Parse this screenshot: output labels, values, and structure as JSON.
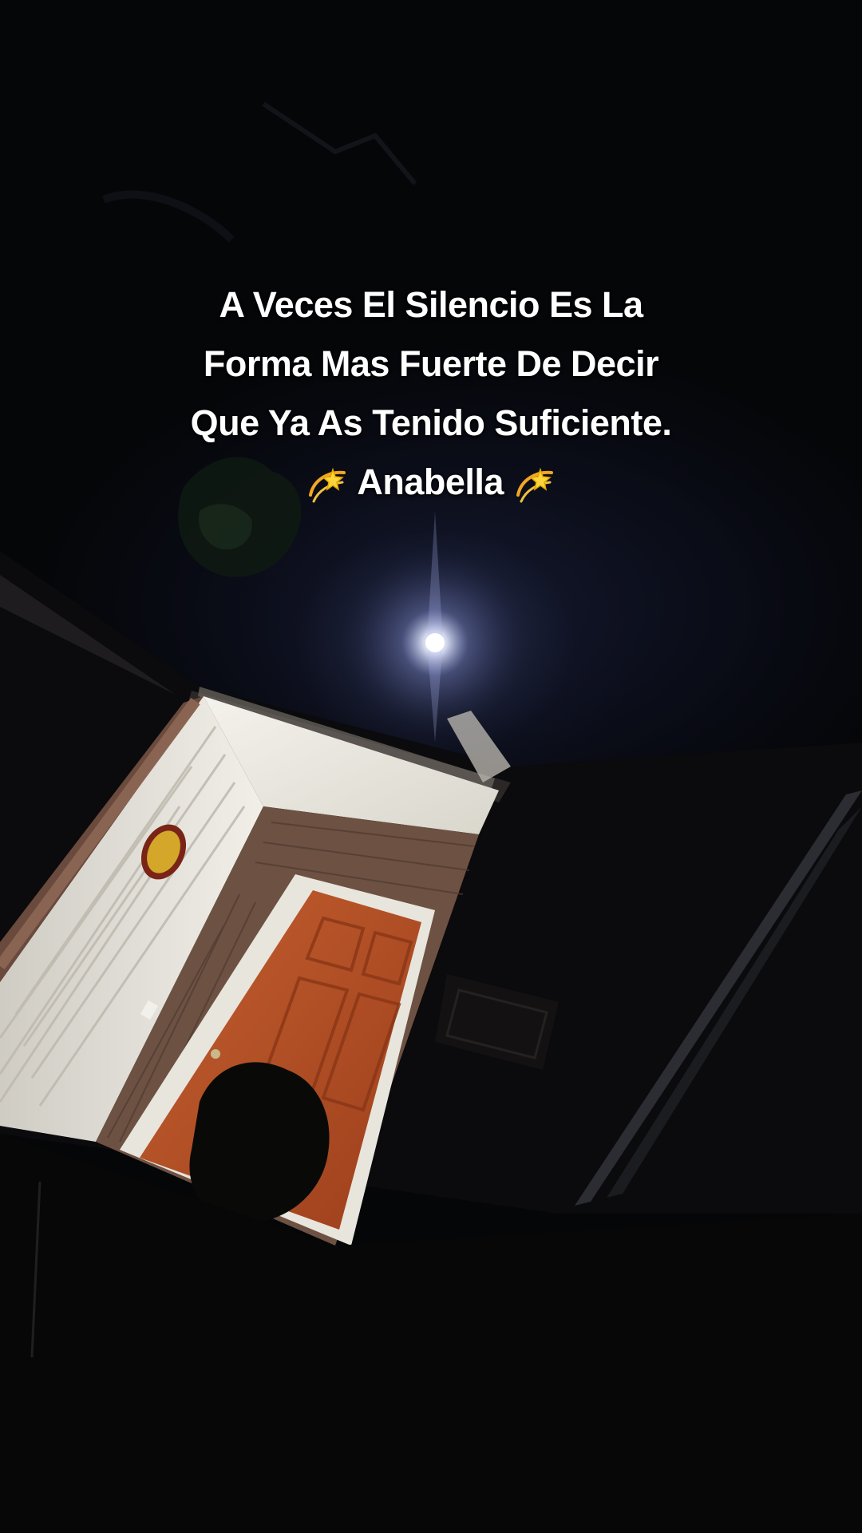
{
  "caption": {
    "lines": [
      "A Veces El Silencio Es La",
      "Forma Mas Fuerte De Decir",
      "Que Ya As Tenido Suficiente."
    ],
    "signature": "Anabella",
    "signature_icon": "dizzy-star-icon"
  },
  "colors": {
    "sky": "#050608",
    "moon_glow": "#cfd8ff",
    "door": "#b8532a",
    "siding": "#e9e7df",
    "brick": "#7c5a4b",
    "text": "#ffffff"
  }
}
